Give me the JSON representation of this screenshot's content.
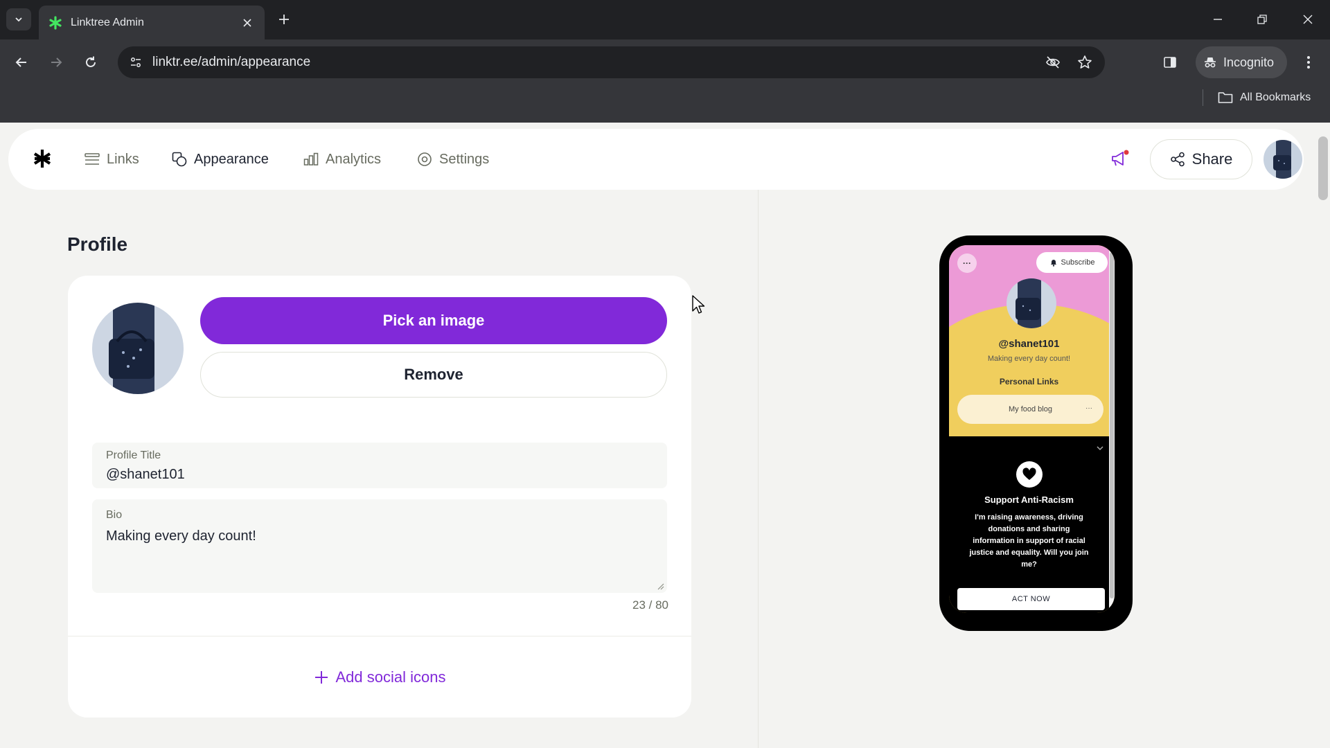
{
  "browser": {
    "tab_title": "Linktree Admin",
    "url": "linktr.ee/admin/appearance",
    "incognito_label": "Incognito",
    "bookmarks_label": "All Bookmarks"
  },
  "nav": {
    "items": [
      {
        "label": "Links",
        "icon": "list-icon"
      },
      {
        "label": "Appearance",
        "icon": "shapes-icon",
        "active": true
      },
      {
        "label": "Analytics",
        "icon": "bar-chart-icon"
      },
      {
        "label": "Settings",
        "icon": "gear-icon"
      }
    ],
    "share_label": "Share"
  },
  "profile": {
    "section_title": "Profile",
    "pick_image_label": "Pick an image",
    "remove_label": "Remove",
    "title_label": "Profile Title",
    "title_value": "@shanet101",
    "bio_label": "Bio",
    "bio_value": "Making every day count!",
    "bio_counter": "23 / 80",
    "add_social_label": "Add social icons"
  },
  "preview": {
    "subscribe_label": "Subscribe",
    "handle": "@shanet101",
    "bio": "Making every day count!",
    "section_label": "Personal Links",
    "link_label": "My food blog",
    "support_title": "Support Anti-Racism",
    "support_text": "I'm raising awareness, driving donations and sharing information in support of racial justice and equality. Will you join me?",
    "act_label": "ACT NOW"
  },
  "colors": {
    "accent_purple": "#8129d9",
    "preview_pink": "#ec9ad6",
    "preview_yellow": "#f0ce5d"
  }
}
